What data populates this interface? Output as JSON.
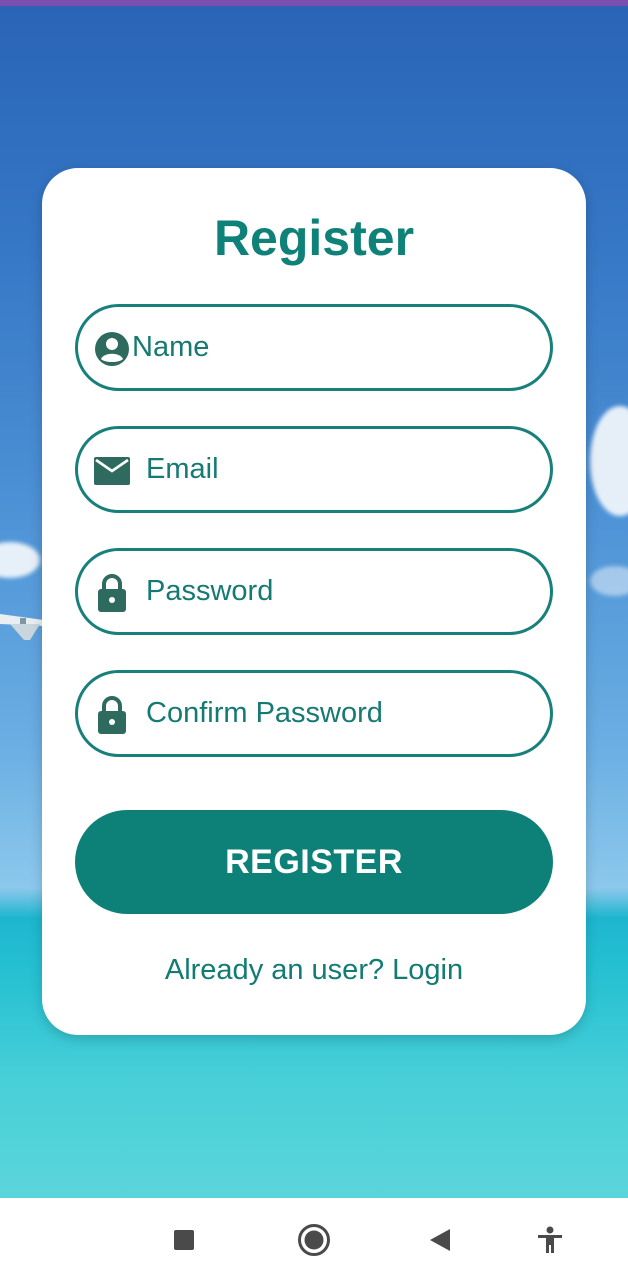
{
  "form": {
    "title": "Register",
    "fields": [
      {
        "placeholder": "Name",
        "icon": "person-icon"
      },
      {
        "placeholder": "Email",
        "icon": "envelope-icon"
      },
      {
        "placeholder": "Password",
        "icon": "lock-icon"
      },
      {
        "placeholder": "Confirm Password",
        "icon": "lock-icon"
      }
    ],
    "register_label": "REGISTER",
    "login_link": "Already an user? Login"
  },
  "navbar": {
    "buttons": [
      "recents-square-icon",
      "home-circle-icon",
      "back-triangle-icon",
      "accessibility-icon"
    ]
  },
  "colors": {
    "accent": "#0d8178",
    "field_border": "#17807a",
    "icon": "#2e6b5e"
  }
}
